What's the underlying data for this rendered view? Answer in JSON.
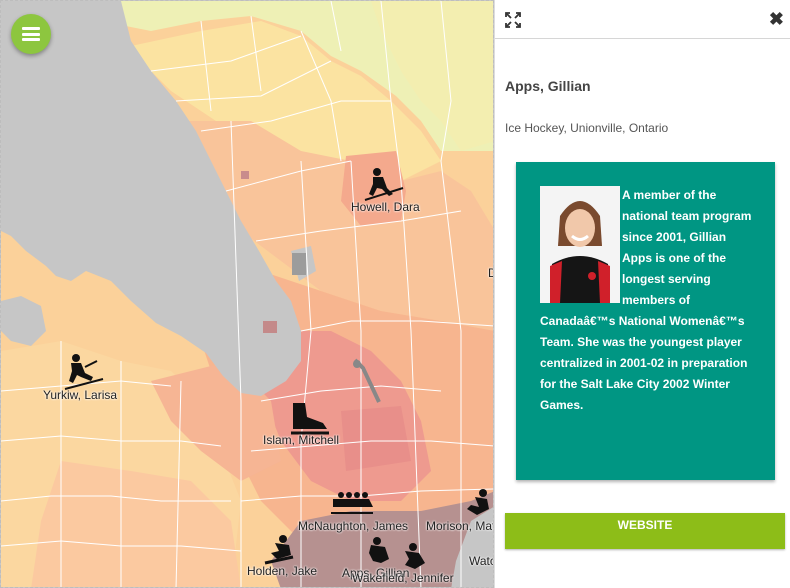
{
  "map": {
    "colors": {
      "water": "#c6c6c6",
      "low": "#eef0b5",
      "low_mid": "#fbe3a1",
      "mid": "#fbd19a",
      "mid_high": "#f7b58f",
      "high": "#ee9a8f",
      "highest": "#b69190",
      "boundary": "#ffffff"
    },
    "markers": [
      {
        "name": "Howell, Dara",
        "icon": "skier-icon"
      },
      {
        "name": "Yurkiw, Larisa",
        "icon": "skier-icon"
      },
      {
        "name": "Islam, Mitchell",
        "icon": "skate-icon"
      },
      {
        "name": "McNaughton, James",
        "icon": "bobsleigh-icon"
      },
      {
        "name": "Morison, Mat",
        "icon": "skier-icon"
      },
      {
        "name": "Holden, Jake",
        "icon": "snowboarder-icon"
      },
      {
        "name": "Apps, Gillian",
        "icon": "skier-icon"
      },
      {
        "name": "Wakefield, Jennifer",
        "icon": "skier-icon"
      },
      {
        "name": "Watc",
        "icon": ""
      },
      {
        "name": "D",
        "icon": ""
      }
    ]
  },
  "menu": {
    "icon": "hamburger-icon",
    "color": "#8dc63f"
  },
  "panel": {
    "expand_icon": "expand-icon",
    "close_label": "✖",
    "athlete_name": "Apps, Gillian",
    "subtitle": "Ice Hockey, Unionville, Ontario",
    "card_color": "#009683",
    "bio": "A member of the national team program since 2001, Gillian Apps is one of the longest serving members of Canadaâ€™s National Womenâ€™s Team. She was the youngest player centralized in 2001-02 in preparation for the Salt Lake City 2002 Winter Games.",
    "website_label": "WEBSITE",
    "button_color": "#8dbd18"
  }
}
